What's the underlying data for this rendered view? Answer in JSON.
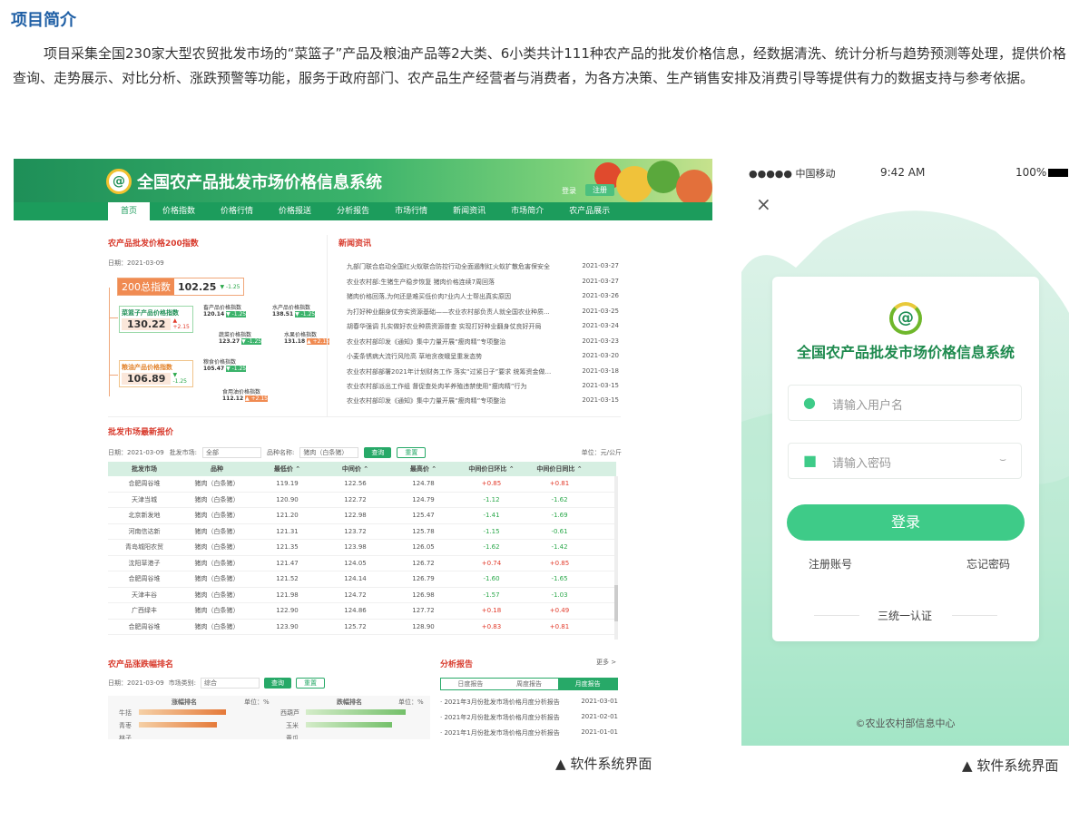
{
  "section_title": "项目简介",
  "intro": "项目采集全国230家大型农贸批发市场的“菜篮子”产品及粮油产品等2大类、6小类共计111种农产品的批发价格信息，经数据清洗、统计分析与趋势预测等处理，提供价格查询、走势展示、对比分析、涨跌预警等功能，服务于政府部门、农产品生产经营者与消费者，为各方决策、生产销售安排及消费引导等提供有力的数据支持与参考依据。",
  "desktop": {
    "logo": "@",
    "title": "全国农产品批发市场价格信息系统",
    "login": "登录",
    "register": "注册",
    "nav": [
      "首页",
      "价格指数",
      "价格行情",
      "价格报送",
      "分析报告",
      "市场行情",
      "新闻资讯",
      "市场简介",
      "农产品展示"
    ],
    "index_panel": {
      "title": "农产品批发价格200指数",
      "date": "日期：2021-03-09",
      "total_label": "200总指数",
      "total_value": "102.25",
      "total_change": "▼ -1.25",
      "veg_label": "菜篮子产品价格指数",
      "veg_value": "130.22",
      "veg_change": "▲ +2.15",
      "grain_label": "粮油产品价格指数",
      "grain_value": "106.89",
      "grain_change": "▼ -1.25",
      "items": [
        {
          "label": "畜产品价格指数",
          "value": "120.14",
          "change": "▼ -1.25"
        },
        {
          "label": "水产品价格指数",
          "value": "138.51",
          "change": "▼ -1.25"
        },
        {
          "label": "蔬菜价格指数",
          "value": "123.27",
          "change": "▼ -1.25"
        },
        {
          "label": "水果价格指数",
          "value": "131.18",
          "change": "▲ +2.15"
        },
        {
          "label": "粮食价格指数",
          "value": "105.47",
          "change": "▼ -1.25"
        },
        {
          "label": "食用油价格指数",
          "value": "112.12",
          "change": "▲ +2.15"
        }
      ]
    },
    "news": {
      "title": "新闻资讯",
      "items": [
        {
          "text": "九部门联合启动全国红火蚁联合防控行动全面遏制红火蚁扩散危害保安全",
          "date": "2021-03-27"
        },
        {
          "text": "农业农村部:生猪生产稳步恢复 猪肉价格连续7周回落",
          "date": "2021-03-27"
        },
        {
          "text": "猪肉价格回落,为何还是难买低价肉?业内人士帮出真实原因",
          "date": "2021-03-26"
        },
        {
          "text": "为打好种业翻身仗夯实资源基础——农业农村部负责人就全国农业种质...",
          "date": "2021-03-25"
        },
        {
          "text": "胡春华强调 扎实做好农业种质资源普查 实现打好种业翻身仗良好开局",
          "date": "2021-03-24"
        },
        {
          "text": "农业农村部印发《通知》集中力量开展“瘦肉精”专项整治",
          "date": "2021-03-23"
        },
        {
          "text": "小麦条锈病大流行风险高 草地贪夜蛾呈重发态势",
          "date": "2021-03-20"
        },
        {
          "text": "农业农村部部署2021年计划财务工作 落实“过紧日子”要求 统筹资金做...",
          "date": "2021-03-18"
        },
        {
          "text": "农业农村部派出工作组 督促查处肉羊养殖违禁使用“瘦肉精”行为",
          "date": "2021-03-15"
        },
        {
          "text": "农业农村部印发《通知》集中力量开展“瘦肉精”专项整治",
          "date": "2021-03-15"
        }
      ]
    },
    "quote": {
      "title": "批发市场最新报价",
      "date": "日期：2021-03-09",
      "market_label": "批发市场:",
      "market_value": "全部",
      "variety_label": "品种名称:",
      "variety_value": "猪肉（白条猪）",
      "search": "查询",
      "reset": "重置",
      "unit": "单位：元/公斤",
      "headers": [
        "批发市场",
        "品种",
        "最低价 ⌃",
        "中间价 ⌃",
        "最高价 ⌃",
        "中间价日环比 ⌃",
        "中间价日同比 ⌃"
      ],
      "rows": [
        [
          "合肥周谷堆",
          "猪肉（白条猪）",
          "119.19",
          "122.56",
          "124.78",
          "+0.85",
          "+0.81"
        ],
        [
          "天津当城",
          "猪肉（白条猪）",
          "120.90",
          "122.72",
          "124.79",
          "-1.12",
          "-1.62"
        ],
        [
          "北京新发地",
          "猪肉（白条猪）",
          "121.20",
          "122.98",
          "125.47",
          "-1.41",
          "-1.69"
        ],
        [
          "河南信达新",
          "猪肉（白条猪）",
          "121.31",
          "123.72",
          "125.78",
          "-1.15",
          "-0.61"
        ],
        [
          "青岛城阳农贸",
          "猪肉（白条猪）",
          "121.35",
          "123.98",
          "126.05",
          "-1.62",
          "-1.42"
        ],
        [
          "沈阳草港子",
          "猪肉（白条猪）",
          "121.47",
          "124.05",
          "126.72",
          "+0.74",
          "+0.85"
        ],
        [
          "合肥周谷堆",
          "猪肉（白条猪）",
          "121.52",
          "124.14",
          "126.79",
          "-1.60",
          "-1.65"
        ],
        [
          "天津丰谷",
          "猪肉（白条猪）",
          "121.98",
          "124.72",
          "126.98",
          "-1.57",
          "-1.03"
        ],
        [
          "广西绿丰",
          "猪肉（白条猪）",
          "122.90",
          "124.86",
          "127.72",
          "+0.18",
          "+0.49"
        ],
        [
          "合肥周谷堆",
          "猪肉（白条猪）",
          "123.90",
          "125.72",
          "128.90",
          "+0.83",
          "+0.81"
        ]
      ]
    },
    "rank": {
      "title": "农产品涨跌幅排名",
      "date": "日期：2021-03-09",
      "type_label": "市场类别:",
      "type_value": "综合",
      "search": "查询",
      "reset": "重置",
      "up_title": "涨幅排名",
      "down_title": "跌幅排名",
      "unit": "单位：%",
      "up_items": [
        "牛括",
        "青枣",
        "林子"
      ],
      "down_items": [
        "西葫芦",
        "玉米",
        "黄瓜"
      ]
    },
    "report": {
      "title": "分析报告",
      "more": "更多 >",
      "tabs": [
        "日度报告",
        "周度报告",
        "月度报告"
      ],
      "items": [
        {
          "text": "· 2021年3月份批发市场价格月度分析报告",
          "date": "2021-03-01"
        },
        {
          "text": "· 2021年2月份批发市场价格月度分析报告",
          "date": "2021-02-01"
        },
        {
          "text": "· 2021年1月份批发市场价格月度分析报告",
          "date": "2021-01-01"
        }
      ]
    },
    "caption": "软件系统界面"
  },
  "mobile": {
    "carrier": "●●●●● 中国移动",
    "time": "9:42 AM",
    "battery": "100%",
    "logo": "@",
    "title": "全国农产品批发市场价格信息系统",
    "username_placeholder": "请输入用户名",
    "password_placeholder": "请输入密码",
    "login": "登录",
    "register": "注册账号",
    "forgot": "忘记密码",
    "sso": "三统一认证",
    "footer": "©农业农村部信息中心",
    "caption": "软件系统界面"
  }
}
